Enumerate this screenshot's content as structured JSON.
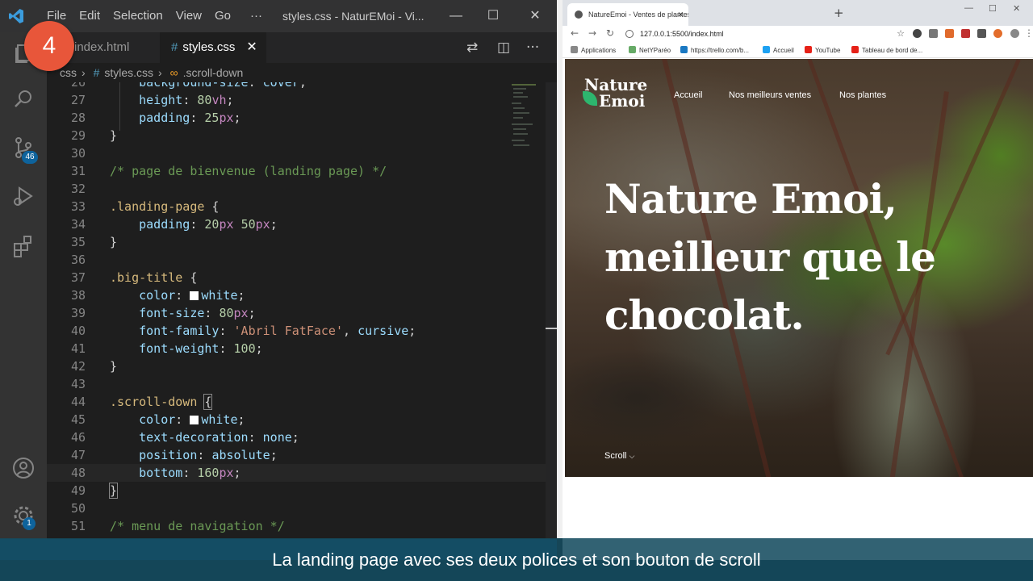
{
  "step_badge": "4",
  "vscode": {
    "menu": [
      "File",
      "Edit",
      "Selection",
      "View",
      "Go",
      "···"
    ],
    "window_title": "styles.css - NaturEMoi - Vi...",
    "tabs": [
      {
        "label": "index.html",
        "active": false
      },
      {
        "label": "styles.css",
        "active": true
      }
    ],
    "breadcrumb": {
      "folder": "css",
      "file": "styles.css",
      "symbol": ".scroll-down"
    },
    "activity_badges": {
      "source_control": "46",
      "settings": "1"
    },
    "code_lines": [
      {
        "n": "26",
        "html": "<span class='c-prop'>    background-size</span>: <span class='c-val'>cover</span>;"
      },
      {
        "n": "27",
        "html": "<span class='c-prop'>    height</span>: <span class='c-num'>80</span><span class='c-unit'>vh</span>;"
      },
      {
        "n": "28",
        "html": "<span class='c-prop'>    padding</span>: <span class='c-num'>25</span><span class='c-unit'>px</span>;"
      },
      {
        "n": "29",
        "html": "}"
      },
      {
        "n": "30",
        "html": ""
      },
      {
        "n": "31",
        "html": "<span class='c-comment'>/* page de bienvenue (landing page) */</span>"
      },
      {
        "n": "32",
        "html": ""
      },
      {
        "n": "33",
        "html": "<span class='c-sel'>.landing-page</span> {"
      },
      {
        "n": "34",
        "html": "<span class='c-prop'>    padding</span>: <span class='c-num'>20</span><span class='c-unit'>px</span> <span class='c-num'>50</span><span class='c-unit'>px</span>;"
      },
      {
        "n": "35",
        "html": "}"
      },
      {
        "n": "36",
        "html": ""
      },
      {
        "n": "37",
        "html": "<span class='c-sel'>.big-title</span> {"
      },
      {
        "n": "38",
        "html": "<span class='c-prop'>    color</span>: <span class='swatch'></span><span class='c-val'>white</span>;"
      },
      {
        "n": "39",
        "html": "<span class='c-prop'>    font-size</span>: <span class='c-num'>80</span><span class='c-unit'>px</span>;"
      },
      {
        "n": "40",
        "html": "<span class='c-prop'>    font-family</span>: <span class='c-str'>'Abril FatFace'</span>, <span class='c-val'>cursive</span>;"
      },
      {
        "n": "41",
        "html": "<span class='c-prop'>    font-weight</span>: <span class='c-num'>100</span>;"
      },
      {
        "n": "42",
        "html": "}"
      },
      {
        "n": "43",
        "html": ""
      },
      {
        "n": "44",
        "html": "<span class='c-sel'>.scroll-down</span> <span class='brace-box'>{</span>"
      },
      {
        "n": "45",
        "html": "<span class='c-prop'>    color</span>: <span class='swatch'></span><span class='c-val'>white</span>;"
      },
      {
        "n": "46",
        "html": "<span class='c-prop'>    text-decoration</span>: <span class='c-val'>none</span>;"
      },
      {
        "n": "47",
        "html": "<span class='c-prop'>    position</span>: <span class='c-val'>absolute</span>;"
      },
      {
        "n": "48",
        "html": "<span class='c-prop'>    bottom</span>: <span class='c-num'>160</span><span class='c-unit'>px</span>;"
      },
      {
        "n": "49",
        "html": "<span class='brace-box'>}</span>"
      },
      {
        "n": "50",
        "html": ""
      },
      {
        "n": "51",
        "html": "<span class='c-comment'>/* menu de navigation */</span>"
      }
    ]
  },
  "browser": {
    "tab_title": "NatureEmoi - Ventes de plantes",
    "url": "127.0.0.1:5500/index.html",
    "bookmarks": [
      "Applications",
      "NetYParéo",
      "https://trello.com/b...",
      "Accueil",
      "YouTube",
      "Tableau de bord de..."
    ],
    "site": {
      "logo_line1": "Nature",
      "logo_line2": "Emoi",
      "nav": [
        "Accueil",
        "Nos meilleurs ventes",
        "Nos plantes"
      ],
      "big_title": "Nature Emoi, meilleur que le chocolat.",
      "scroll_label": "Scroll",
      "scroll_icon": "chevron-down-icon"
    }
  },
  "caption": "La landing page avec ses deux polices et son bouton de scroll",
  "colors": {
    "step_badge": "#e8563a",
    "caption_bg": "#164c60",
    "vscode_bg": "#1e1e1e"
  }
}
